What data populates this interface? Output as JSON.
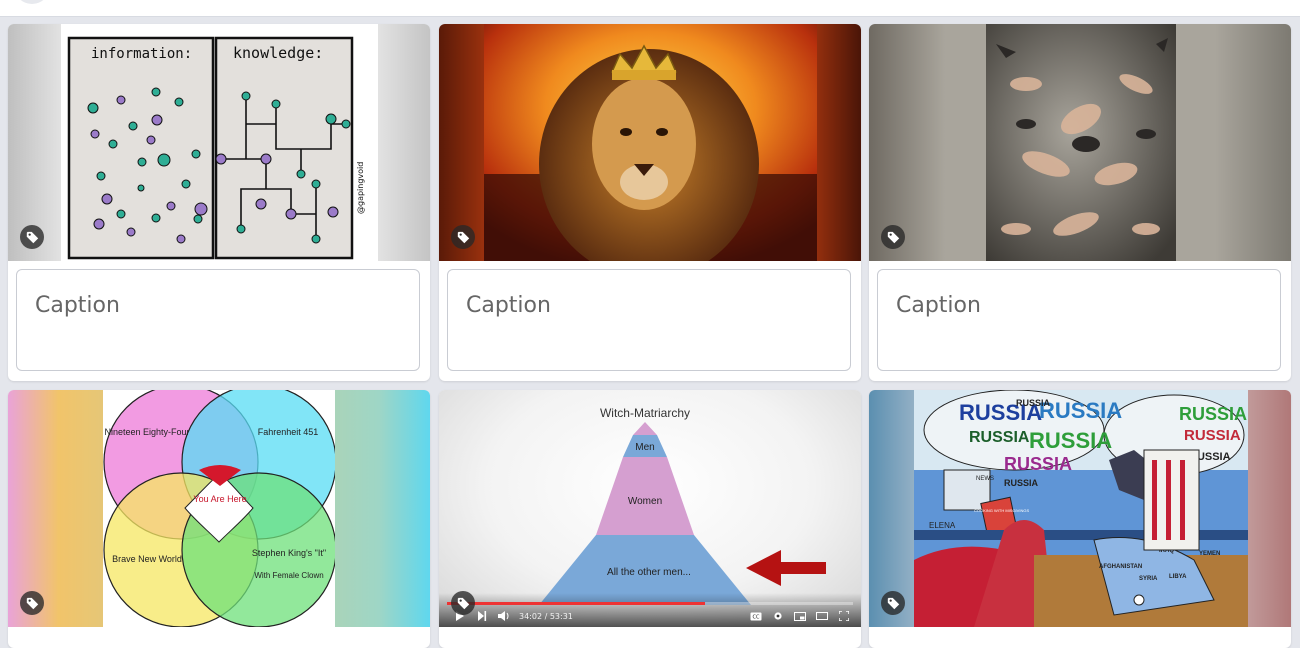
{
  "caption_placeholder": "Caption",
  "cards": [
    {
      "id": "card-1",
      "image": {
        "panel_left_title": "information:",
        "panel_right_title": "knowledge:",
        "signature": "@gapingvoid"
      }
    },
    {
      "id": "card-2",
      "image": {
        "subject": "lion-with-crown"
      }
    },
    {
      "id": "card-3",
      "image": {
        "subject": "witches-painting"
      }
    },
    {
      "id": "card-4",
      "image": {
        "circle_top_left": "Nineteen Eighty-Four",
        "circle_top_right": "Fahrenheit 451",
        "circle_bottom_left": "Brave New World",
        "circle_bottom_right_line1": "Stephen King's \"It\"",
        "circle_bottom_right_line2": "With Female Clown",
        "center": "You Are Here"
      }
    },
    {
      "id": "card-5",
      "video": {
        "title": "Witch-Matriarchy",
        "levels": [
          "Men",
          "Women",
          "All the other men..."
        ],
        "time": "34:02 / 53:31",
        "progress": 0.636
      }
    },
    {
      "id": "card-6",
      "image": {
        "bubble_words": [
          "RUSSIA",
          "RUSSIA",
          "RUSSIA",
          "RUSSIA",
          "RUSSIA",
          "RUSSIA",
          "RUSSIA",
          "RUSSIA",
          "RUSSIA",
          "RUSSIA"
        ],
        "box_label": "COOKING WITH MISGIVINGS",
        "monitor_label": "NEWS",
        "map_labels": [
          "IRAQ",
          "SYRIA",
          "LIBYA",
          "YEMEN",
          "AFGHANISTAN"
        ],
        "counter_text": "ELENA"
      }
    }
  ]
}
